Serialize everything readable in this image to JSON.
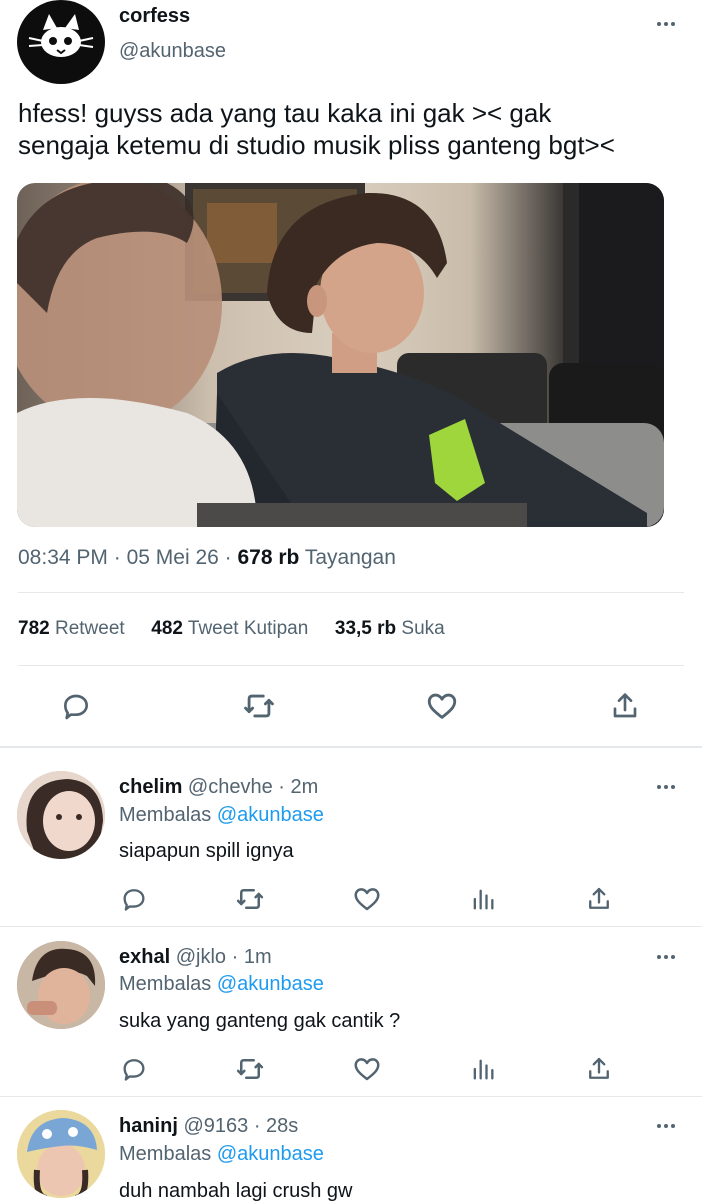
{
  "tweet": {
    "display_name": "corfess",
    "handle": "@akunbase",
    "text_line1": "hfess! guyss ada yang tau kaka ini gak >< gak",
    "text_line2": "sengaja ketemu di studio musik pliss ganteng bgt><",
    "time": "08:34 PM",
    "sep1": "·",
    "date": "05 Mei 26",
    "sep2": "·",
    "views_count": "678 rb",
    "views_label": "Tayangan"
  },
  "stats": {
    "retweets_count": "782",
    "retweets_label": "Retweet",
    "quotes_count": "482",
    "quotes_label": "Tweet Kutipan",
    "likes_count": "33,5 rb",
    "likes_label": "Suka"
  },
  "replies": [
    {
      "name": "chelim",
      "handle": "@chevhe",
      "sep": "·",
      "time": "2m",
      "replying_prefix": "Membalas",
      "replying_to": "@akunbase",
      "text": "siapapun spill ignya"
    },
    {
      "name": "exhal",
      "handle": "@jklo",
      "sep": "·",
      "time": "1m",
      "replying_prefix": "Membalas",
      "replying_to": "@akunbase",
      "text": "suka yang ganteng gak cantik ?"
    },
    {
      "name": "haninj",
      "handle": "@9163",
      "sep": "·",
      "time": "28s",
      "replying_prefix": "Membalas",
      "replying_to": "@akunbase",
      "text": "duh nambah lagi crush gw"
    }
  ],
  "colors": {
    "accent": "#1d9bf0",
    "muted": "#536471",
    "divider": "#e6e9eb",
    "text": "#0f1419"
  },
  "icons": [
    "cat-logo-icon",
    "more-icon",
    "reply-icon",
    "retweet-icon",
    "like-icon",
    "share-icon",
    "views-icon"
  ]
}
